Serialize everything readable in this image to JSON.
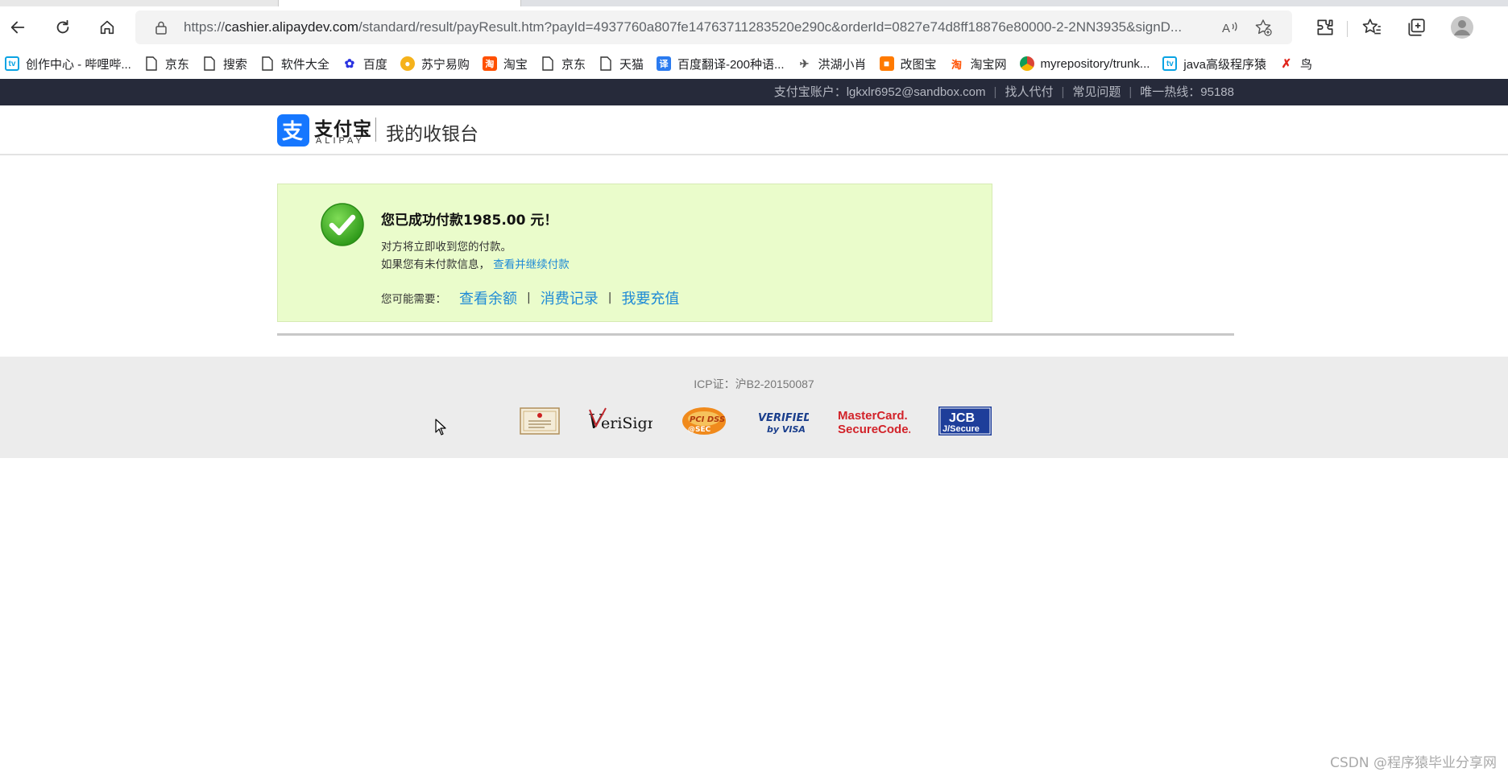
{
  "browser": {
    "url_prefix": "https://",
    "url_host": "cashier.alipaydev.com",
    "url_rest": "/standard/result/payResult.htm?payId=4937760a807fe14763711283520e290c&orderId=0827e74d8ff18876e80000-2-2NN3935&signD...",
    "bookmarks": [
      {
        "label": "创作中心 - 哔哩哔...",
        "icon": "bilibili-icon"
      },
      {
        "label": "京东",
        "icon": "page-icon"
      },
      {
        "label": "搜索",
        "icon": "page-icon"
      },
      {
        "label": "软件大全",
        "icon": "page-icon"
      },
      {
        "label": "百度",
        "icon": "baidu-icon"
      },
      {
        "label": "苏宁易购",
        "icon": "suning-icon"
      },
      {
        "label": "淘宝",
        "icon": "taobao-icon"
      },
      {
        "label": "京东",
        "icon": "page-icon"
      },
      {
        "label": "天猫",
        "icon": "page-icon"
      },
      {
        "label": "百度翻译-200种语...",
        "icon": "translate-icon"
      },
      {
        "label": "洪湖小肖",
        "icon": "bird-icon"
      },
      {
        "label": "改图宝",
        "icon": "gaitubao-icon"
      },
      {
        "label": "淘宝网",
        "icon": "taobao-icon"
      },
      {
        "label": "myrepository/trunk...",
        "icon": "chrome-icon"
      },
      {
        "label": "java高级程序猿",
        "icon": "bilibili-icon"
      },
      {
        "label": "鸟",
        "icon": "bird-red-icon"
      }
    ]
  },
  "topbar": {
    "account": "支付宝账户：lgkxlr6952@sandbox.com",
    "find_payer": "找人代付",
    "faq": "常见问题",
    "hotline": "唯一热线：95188"
  },
  "header": {
    "logo_cn": "支付宝",
    "logo_en": "ALIPAY",
    "title": "我的收银台"
  },
  "result": {
    "title": "您已成功付款1985.00 元！",
    "line1": "对方将立即收到您的付款。",
    "line2_prefix": "如果您有未付款信息，",
    "line2_link": "查看并继续付款",
    "maybe_label": "您可能需要：",
    "link_balance": "查看余额",
    "link_records": "消费记录",
    "link_recharge": "我要充值",
    "pipe": "|"
  },
  "footer": {
    "icp": "ICP证：沪B2-20150087",
    "certs": [
      "cert-badge",
      "VeriSign",
      "PCI DSS",
      "VERIFIED by VISA",
      "MasterCard. SecureCode.",
      "JCB J/Secure"
    ]
  },
  "watermark": "CSDN @程序猿毕业分享网",
  "colors": {
    "topbar_bg": "#262a3a",
    "result_bg": "#eafccb",
    "link": "#1e8ad6",
    "alipay_blue": "#1677ff"
  }
}
